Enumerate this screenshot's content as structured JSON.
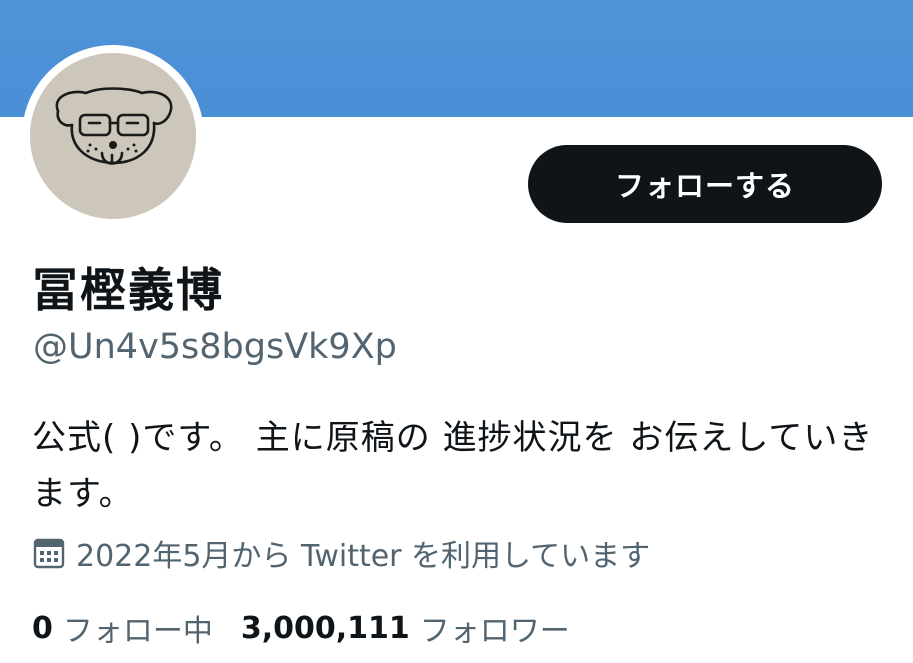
{
  "profile": {
    "display_name": "冨樫義博",
    "handle": "@Un4v5s8bgsVk9Xp",
    "bio": "公式( )です。 主に原稿の 進捗状況を お伝えしていきます。",
    "joined": "2022年5月から Twitter を利用しています",
    "joined_icon": "calendar-icon",
    "avatar": "cartoon-face-avatar"
  },
  "actions": {
    "follow_label": "フォローする"
  },
  "stats": {
    "following_count": "0",
    "following_label": "フォロー中",
    "followers_count": "3,000,111",
    "followers_label": "フォロワー"
  },
  "colors": {
    "banner": "#4f93d8",
    "button_bg": "#0f1419",
    "secondary_text": "#536471"
  }
}
